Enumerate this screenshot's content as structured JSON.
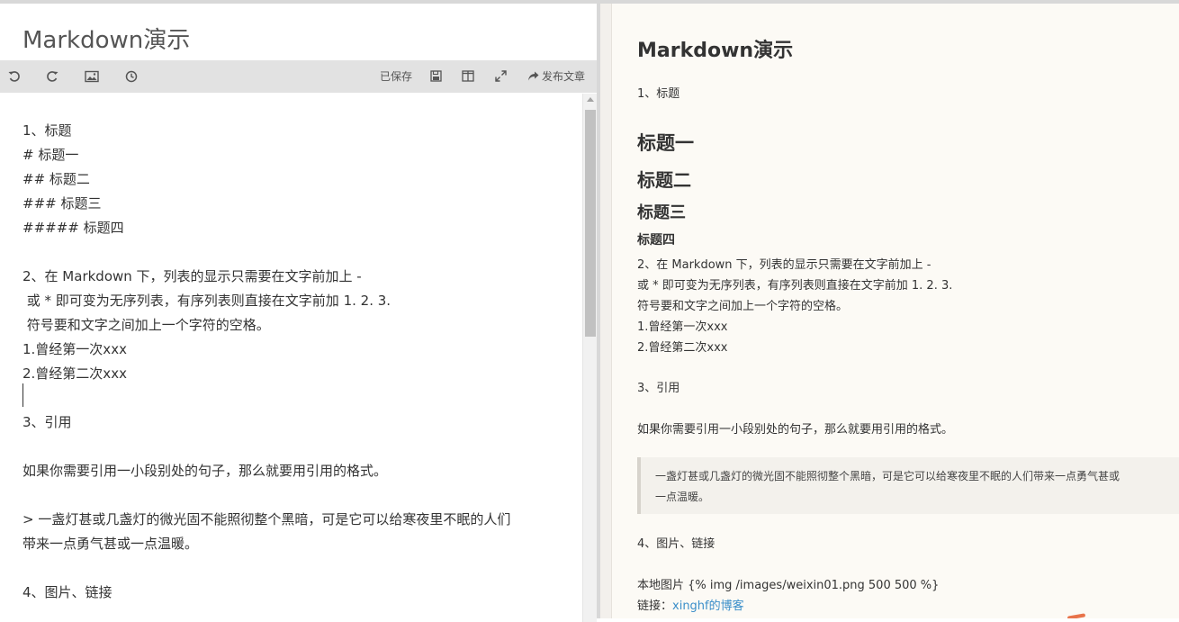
{
  "editor": {
    "title": "Markdown演示",
    "toolbar": {
      "saved_status": "已保存",
      "publish_label": "发布文章"
    },
    "lines": [
      "1、标题",
      "# 标题一",
      "## 标题二",
      "### 标题三",
      "##### 标题四",
      "",
      "2、在 Markdown 下，列表的显示只需要在文字前加上 -",
      " 或 * 即可变为无序列表，有序列表则直接在文字前加 1. 2. 3.",
      " 符号要和文字之间加上一个字符的空格。",
      "1.曾经第一次xxx",
      "2.曾经第二次xxx",
      "",
      "3、引用",
      "",
      "如果你需要引用一小段别处的句子，那么就要用引用的格式。",
      "",
      "> 一盏灯甚或几盏灯的微光固不能照彻整个黑暗，可是它可以给寒夜里不眠的人们",
      "带来一点勇气甚或一点温暖。",
      "",
      "4、图片、链接"
    ]
  },
  "preview": {
    "title": "Markdown演示",
    "section1": "1、标题",
    "h1": "标题一",
    "h2": "标题二",
    "h3": "标题三",
    "h4": "标题四",
    "list_intro_1": "2、在 Markdown 下，列表的显示只需要在文字前加上 -",
    "list_intro_2": "或 * 即可变为无序列表，有序列表则直接在文字前加 1. 2. 3.",
    "list_intro_3": "符号要和文字之间加上一个字符的空格。",
    "item1": "1.曾经第一次xxx",
    "item2": "2.曾经第二次xxx",
    "section3": "3、引用",
    "quote_intro": "如果你需要引用一小段别处的句子，那么就要用引用的格式。",
    "quote_line1": "一盏灯甚或几盏灯的微光固不能照彻整个黑暗，可是它可以给寒夜里不眠的人们带来一点勇气甚或",
    "quote_line2": "一点温暖。",
    "section4": "4、图片、链接",
    "local_image": "本地图片 {% img /images/weixin01.png 500 500 %}",
    "link_prefix": "链接：",
    "link_text": "xinghf的博客"
  },
  "icons": {
    "undo": "undo-icon",
    "redo": "redo-icon",
    "image": "image-icon",
    "history": "history-icon",
    "save": "save-icon",
    "split": "split-view-icon",
    "fullscreen": "fullscreen-icon",
    "publish": "share-icon"
  },
  "colors": {
    "toolbar_bg": "#e2e2e2",
    "preview_bg": "#fcfaf5",
    "link": "#3a8ec9"
  }
}
